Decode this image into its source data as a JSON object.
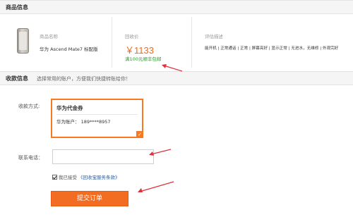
{
  "goods": {
    "section_title": "商品信息",
    "name_label": "商品名称",
    "name_value": "华为 Ascend Mate7 标配版",
    "price_label": "回收价",
    "price_value": "￥1133",
    "price_promo": "满100元顺丰包邮",
    "eval_label": "评估描述",
    "eval_value": "能开机 | 正常通话 | 正常 | 屏幕亮好 | 显示正常 | 无进水，无维修 | 外观完好"
  },
  "payment": {
    "section_title": "收款信息",
    "hint": "选择常用的账户，方便我们快捷转账给你！",
    "method_label": "收款方式:",
    "method_name": "华为代金券",
    "method_account": "华为账户：  189****8957",
    "method_check": "✓",
    "phone_label": "联系电话：",
    "phone_value": "",
    "agree_prefix": "我已接受",
    "agree_link": "《回收宝服务条款》",
    "submit_label": "提交订单"
  },
  "colors": {
    "accent": "#f26d22",
    "price": "#f26a1b",
    "promo": "#2aa12a",
    "arrow": "#e0303a"
  }
}
